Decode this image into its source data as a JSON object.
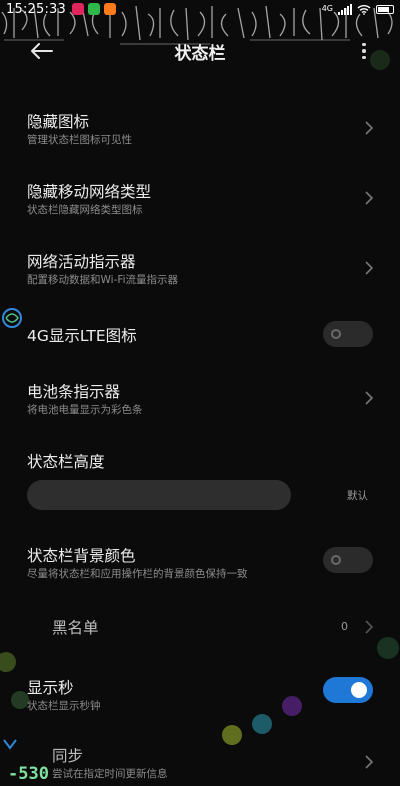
{
  "status_bar": {
    "time": "15:25:33",
    "app_icons": [
      "tiktok-icon",
      "phone-app-icon",
      "video-app-icon"
    ],
    "network": "4G",
    "wifi": "wifi-icon"
  },
  "header": {
    "title": "状态栏",
    "back_icon": "back-arrow-icon",
    "more_icon": "more-vertical-icon"
  },
  "settings": [
    {
      "title": "隐藏图标",
      "subtitle": "管理状态栏图标可见性",
      "control": "chevron"
    },
    {
      "title": "隐藏移动网络类型",
      "subtitle": "状态栏隐藏网络类型图标",
      "control": "chevron"
    },
    {
      "title": "网络活动指示器",
      "subtitle": "配置移动数据和Wi-Fi流量指示器",
      "control": "chevron"
    },
    {
      "title": "4G显示LTE图标",
      "subtitle": "",
      "control": "toggle",
      "on": false
    },
    {
      "title": "电池条指示器",
      "subtitle": "将电池电量显示为彩色条",
      "control": "chevron"
    }
  ],
  "height_setting": {
    "title": "状态栏高度",
    "value": "默认"
  },
  "background_color": {
    "title": "状态栏背景颜色",
    "subtitle": "尽量将状态栏和应用操作栏的背景颜色保持一致",
    "on": false
  },
  "blacklist": {
    "title": "黑名单",
    "count": "0"
  },
  "show_seconds": {
    "title": "显示秒",
    "subtitle": "状态栏显示秒钟",
    "on": true
  },
  "sync": {
    "title": "同步",
    "subtitle": "尝试在指定时间更新信息"
  },
  "overlay_counter": "-530",
  "colors": {
    "background": "#0b0b0b",
    "toggle_on": "#1f77d6",
    "toggle_off": "#2b2b2b",
    "subtitle": "#8c8c8c"
  }
}
